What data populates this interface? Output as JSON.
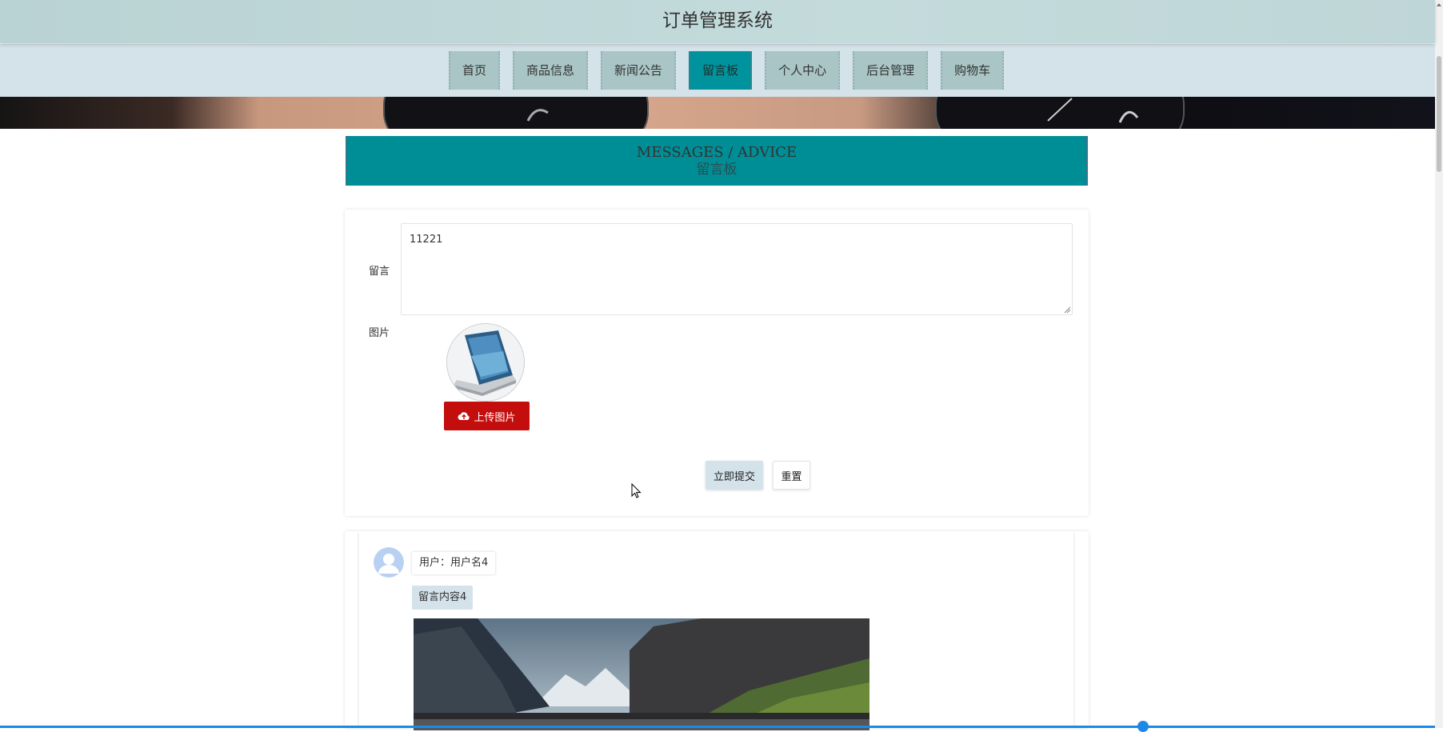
{
  "app": {
    "title": "订单管理系统"
  },
  "nav": {
    "items": [
      {
        "label": "首页"
      },
      {
        "label": "商品信息"
      },
      {
        "label": "新闻公告"
      },
      {
        "label": "留言板",
        "active": true
      },
      {
        "label": "个人中心"
      },
      {
        "label": "后台管理"
      },
      {
        "label": "购物车"
      }
    ]
  },
  "section": {
    "title_en": "MESSAGES / ADVICE",
    "title_cn": "留言板"
  },
  "form": {
    "message_label": "留言",
    "message_value": "11221",
    "image_label": "图片",
    "upload_label": "上传图片",
    "submit_label": "立即提交",
    "reset_label": "重置"
  },
  "comments": [
    {
      "user": "用户：用户名4",
      "content": "留言内容4"
    }
  ],
  "colors": {
    "header": "#bfd6d8",
    "nav_bg": "#d4e2ea",
    "nav_item": "#a9c5c5",
    "nav_active": "#00939d",
    "title_box": "#008e96",
    "upload_button": "#c40e0e",
    "progress": "#1e88e5"
  },
  "icons": {
    "upload": "cloud-upload-icon",
    "avatar": "user-avatar-icon"
  }
}
